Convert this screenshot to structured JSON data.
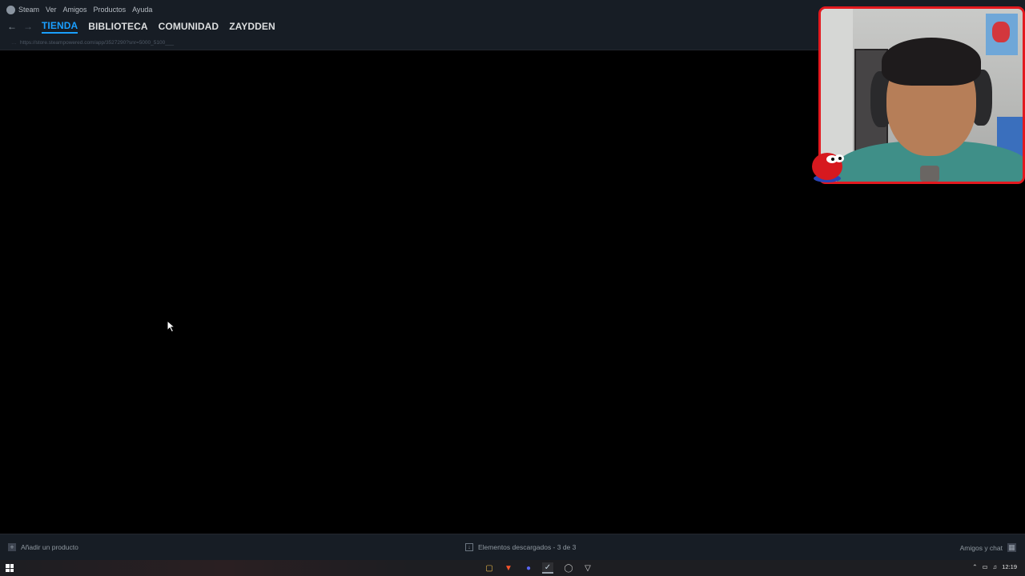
{
  "menu": {
    "items": [
      "Steam",
      "Ver",
      "Amigos",
      "Productos",
      "Ayuda"
    ]
  },
  "nav": {
    "back_icon": "arrow-left-icon",
    "forward_icon": "arrow-right-icon",
    "tabs": [
      "TIENDA",
      "BIBLIOTECA",
      "COMUNIDAD",
      "ZAYDDEN"
    ],
    "active_tab": "TIENDA"
  },
  "url": {
    "text": "https://store.steampowered.com/app/3527290?snr=5000_5100___"
  },
  "statusbar": {
    "add_product": "Añadir un producto",
    "downloads": "Elementos descargados - 3 de 3",
    "friends": "Amigos y chat"
  },
  "taskbar": {
    "apps": [
      "folder-icon",
      "brave-icon",
      "discord-icon",
      "steam-icon",
      "clock-icon",
      "vivaldi-icon"
    ],
    "clock": "12:19"
  },
  "colors": {
    "accent": "#1a9fff",
    "webcam_border": "#e3191f",
    "chrome_bg": "#171d25"
  }
}
